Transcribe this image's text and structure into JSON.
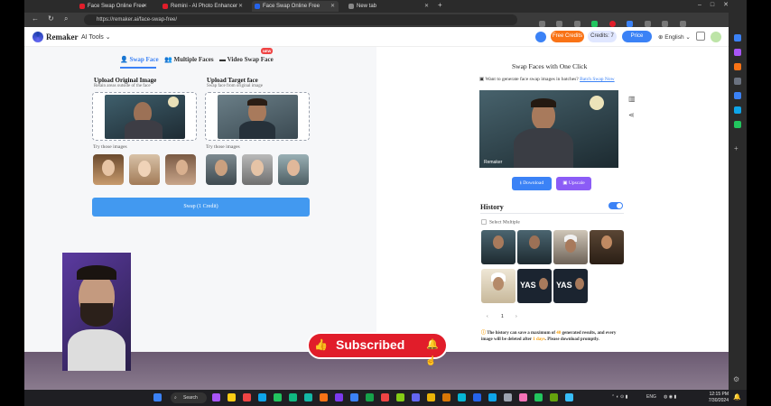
{
  "browser": {
    "tabs": [
      {
        "label": "Face Swap Online Free",
        "active": false,
        "icon_color": "#e11d2a"
      },
      {
        "label": "Remini - AI Photo Enhancer",
        "active": false,
        "icon_color": "#e11d2a"
      },
      {
        "label": "Face Swap Online Free",
        "active": true,
        "icon_color": "#2563eb"
      },
      {
        "label": "New tab",
        "active": false,
        "icon_color": "#888888"
      }
    ],
    "new_tab_symbol": "+",
    "url": "https://remaker.ai/face-swap-free/"
  },
  "header": {
    "brand": "Remaker",
    "ai_tools": "AI Tools",
    "free_credits": "Free Credits",
    "credits": "Credits: 7",
    "price": "Price",
    "language": "English"
  },
  "left": {
    "tabs": [
      "Swap Face",
      "Multiple Faces",
      "Video Swap Face"
    ],
    "new_badge": "NEW",
    "upload_original_title": "Upload Original Image",
    "upload_original_sub": "Retain areas outside of the face",
    "upload_target_title": "Upload Target face",
    "upload_target_sub": "Swap face from original image",
    "try_label_1": "Try those images",
    "try_label_2": "Try those images",
    "swap_button": "Swap (1 Credit)"
  },
  "right": {
    "title": "Swap Faces with One Click",
    "batch_text": "Want to generate face swap images in batches?",
    "batch_link": "Batch Swap Now",
    "watermark": "Remaker",
    "download": "Download",
    "upscale": "Upscale",
    "history_title": "History",
    "select_multiple": "Select Multiple",
    "history_thumb_text": "YAS",
    "pager": {
      "prev": "‹",
      "page": "1",
      "next": "›"
    },
    "note_prefix": "The history can save a maximum of ",
    "note_max": "40",
    "note_mid": " generated results, and every image will be deleted after ",
    "note_days": "1 days",
    "note_suffix": ". Please download promptly."
  },
  "overlay": {
    "subscribed": "Subscribed"
  },
  "taskbar": {
    "search": "Search",
    "lang": "ENG",
    "time": "12:15 PM",
    "date": "7/30/2024"
  },
  "colors": {
    "accent": "#3b82f6",
    "free_credits": "#f97316",
    "price": "#3b82f6",
    "upscale": "#8b5cf6",
    "subscribe_red": "#e11d2a"
  }
}
